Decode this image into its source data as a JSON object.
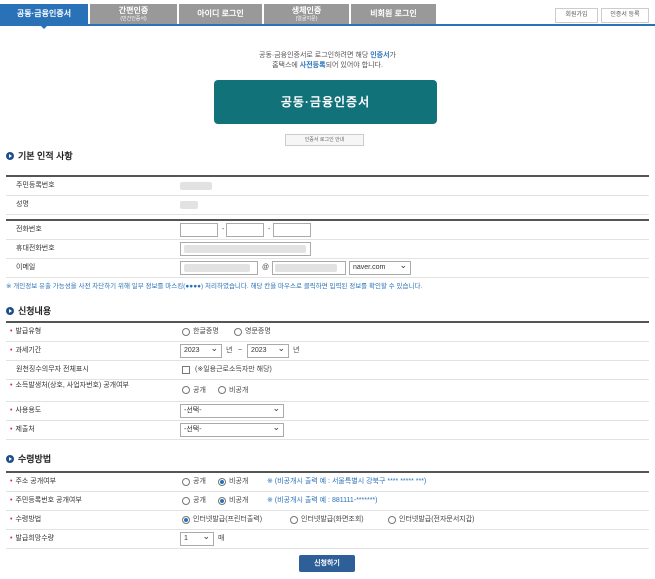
{
  "tabs": [
    {
      "label": "공동·금융인증서",
      "sub": ""
    },
    {
      "label": "간편인증",
      "sub": "(민간인증서)"
    },
    {
      "label": "아이디 로그인",
      "sub": ""
    },
    {
      "label": "생체인증",
      "sub": "(얼굴지문)"
    },
    {
      "label": "비회원 로그인",
      "sub": ""
    }
  ],
  "top_buttons": {
    "join": "회원가입",
    "cert_register": "인증서 등록"
  },
  "intro": {
    "line1_pre": "공동·금융인증서로 로그인하려면 해당 ",
    "line1_em": "인증서",
    "line1_post": "가",
    "line2_pre": "홈택스에 ",
    "line2_em": "사전등록",
    "line2_post": "되어 있어야 합니다.",
    "main_button": "공동·금융인증서",
    "guide_button": "인증서 로그인 안내"
  },
  "basic": {
    "title": "기본 인적 사항",
    "labels": {
      "resident_no": "주민등록번호",
      "name": "성명",
      "phone": "전화번호",
      "mobile": "휴대전화번호",
      "email": "이메일"
    },
    "email_at": "@",
    "email_domain": "naver.com",
    "dash": "-",
    "note": "※ 개인정보 유출 가능성을 사전 차단하기 위해 일부 정보를 마스킹(●●●●) 처리하였습니다. 해당 칸을 마우스로 클릭하면 입력된 정보를 확인할 수 있습니다."
  },
  "apply": {
    "title": "신청내용",
    "labels": {
      "issue_type": "발급유형",
      "period": "과세기간",
      "withholding": "원천징수의무자 전체표시",
      "disclosure": "소득발생처(상호, 사업자번호) 공개여부",
      "purpose": "사용용도",
      "submit_to": "제출처"
    },
    "issue_options": [
      "한글증명",
      "영문증명"
    ],
    "year_from": "2023",
    "year_to": "2023",
    "year_unit": "년",
    "tilde": "~",
    "withholding_text": "(※일용근로소득자만 해당)",
    "disclosure_options": [
      "공개",
      "비공개"
    ],
    "select_placeholder": "-선택-"
  },
  "receive": {
    "title": "수령방법",
    "labels": {
      "address_public": "주소 공개여부",
      "resident_public": "주민등록번호 공개여부",
      "method": "수령방법",
      "copies": "발급희망수량"
    },
    "public_options": [
      "공개",
      "비공개"
    ],
    "address_example": "※ (비공개시 출력 예 : 서울특별시 강북구 **** ***** ***)",
    "resident_example": "※ (비공개시 출력 예 : 881111-*******)",
    "method_options": [
      "인터넷발급(프린터출력)",
      "인터넷발급(화면조회)",
      "인터넷발급(전자문서지갑)"
    ],
    "copies_value": "1",
    "copies_unit": "매"
  },
  "submit_label": "신청하기"
}
